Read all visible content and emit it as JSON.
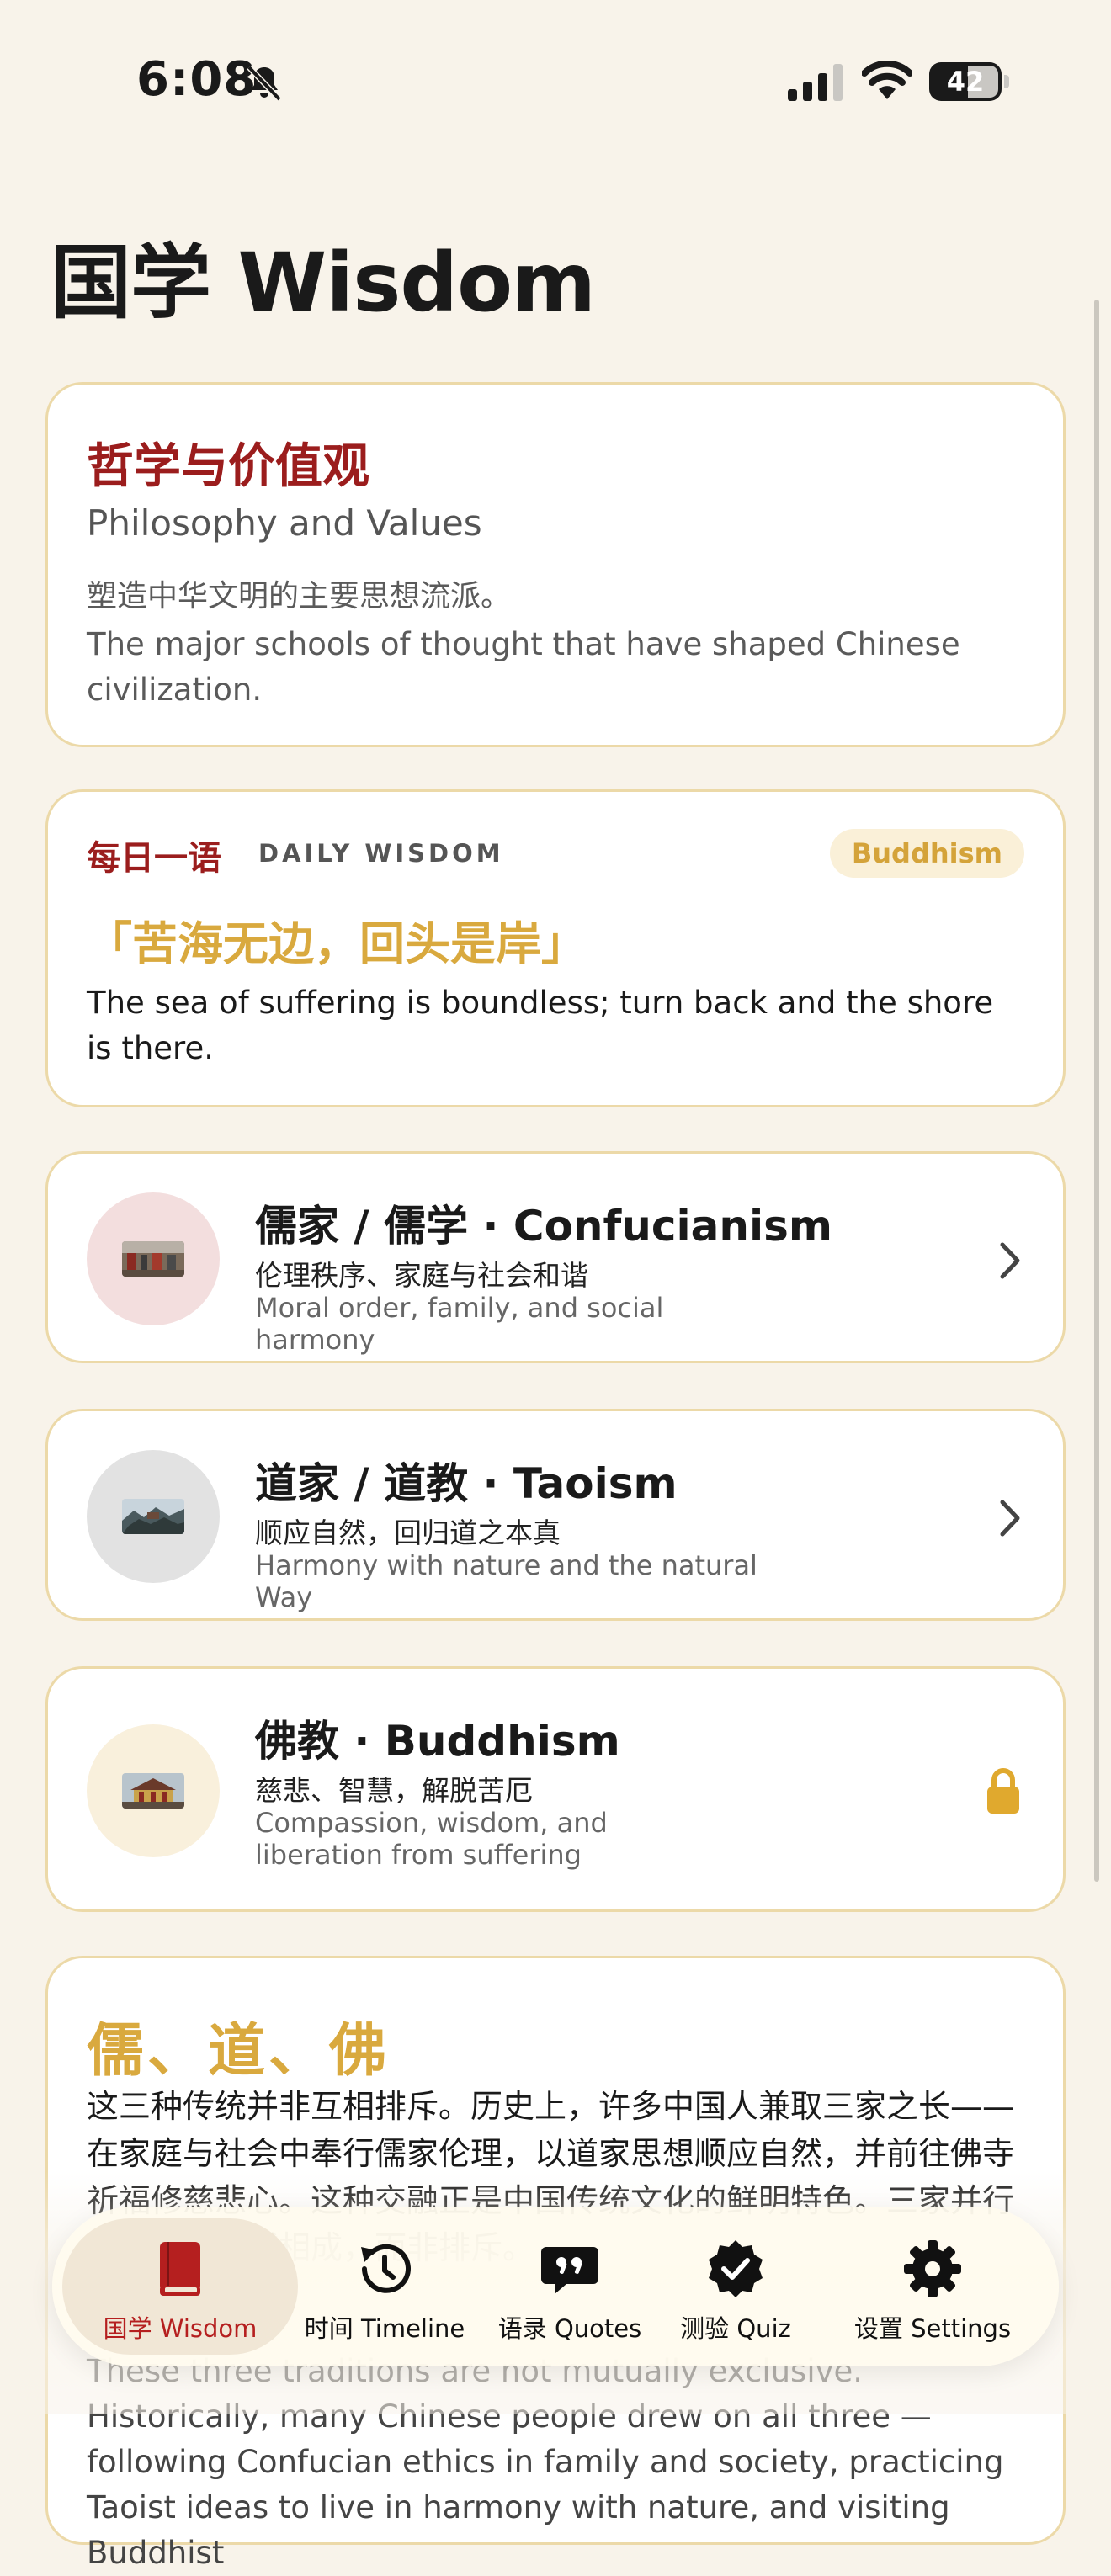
{
  "status_bar": {
    "time": "6:08",
    "battery": "42"
  },
  "page": {
    "title": "国学 Wisdom"
  },
  "intro": {
    "title_zh": "哲学与价值观",
    "title_en": "Philosophy and Values",
    "desc_zh": "塑造中华文明的主要思想流派。",
    "desc_en": "The major schools of thought that have shaped Chinese civilization."
  },
  "daily": {
    "label_zh": "每日一语",
    "label_en": "DAILY WISDOM",
    "badge": "Buddhism",
    "quote_zh": "「苦海无边，回头是岸」",
    "quote_en": "The sea of suffering is boundless; turn back and the shore is there."
  },
  "traditions": [
    {
      "title": "儒家 / 儒学 · Confucianism",
      "subtitle_zh": "伦理秩序、家庭与社会和谐",
      "subtitle_en": "Moral order, family, and social harmony",
      "locked": false,
      "avatar_bg": "#f3dede"
    },
    {
      "title": "道家 / 道教 · Taoism",
      "subtitle_zh": "顺应自然，回归道之本真",
      "subtitle_en": "Harmony with nature and the natural Way",
      "locked": false,
      "avatar_bg": "#e2e2e2"
    },
    {
      "title": "佛教 · Buddhism",
      "subtitle_zh": "慈悲、智慧，解脱苦厄",
      "subtitle_en": "Compassion, wisdom, and liberation from suffering",
      "locked": true,
      "avatar_bg": "#f9f0dc"
    }
  ],
  "essay": {
    "title": "儒、道、佛",
    "body_zh": "这三种传统并非互相排斥。历史上，许多中国人兼取三家之长——在家庭与社会中奉行儒家伦理，以道家思想顺应自然，并前往佛寺祈福修慈悲心。这种交融正是中国传统文化的鲜明特色。三家并行而不悖，相辅相成，而非排斥。",
    "body_en": "These three traditions are not mutually exclusive. Historically, many Chinese people drew on all three — following Confucian ethics in family and society, practicing Taoist ideas to live in harmony with nature, and visiting Buddhist"
  },
  "tabs": [
    {
      "label": "国学 Wisdom",
      "icon": "book-icon",
      "active": true
    },
    {
      "label": "时间 Timeline",
      "icon": "history-icon",
      "active": false
    },
    {
      "label": "语录 Quotes",
      "icon": "quote-bubble-icon",
      "active": false
    },
    {
      "label": "测验 Quiz",
      "icon": "checkmark-seal-icon",
      "active": false
    },
    {
      "label": "设置 Settings",
      "icon": "gear-icon",
      "active": false
    }
  ],
  "colors": {
    "accent_red": "#9b1d1d",
    "gold": "#d9a93e",
    "card_border": "#ecd9a8",
    "background": "#f8f3ea"
  }
}
